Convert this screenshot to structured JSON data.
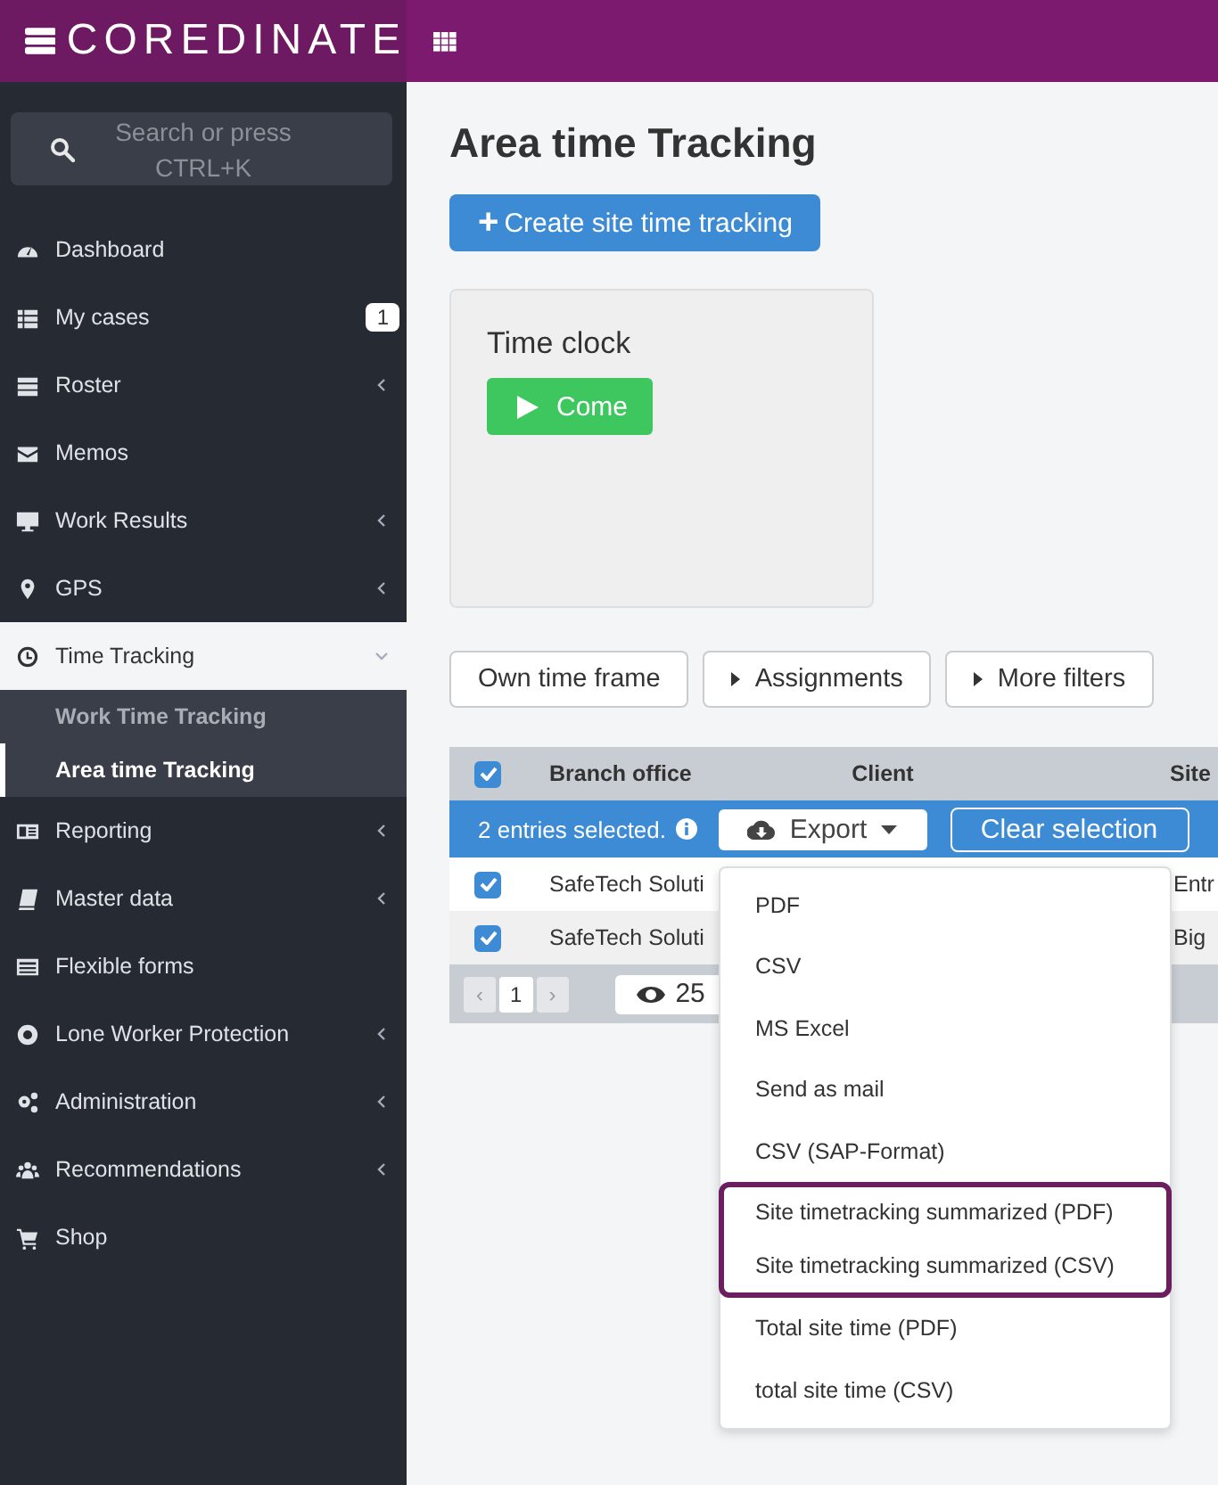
{
  "brand": {
    "name": "COREDINATE"
  },
  "search": {
    "placeholder": "Search or press CTRL+K"
  },
  "sidebar": {
    "items": [
      {
        "label": "Dashboard",
        "has_submenu": false,
        "selected": false
      },
      {
        "label": "My cases",
        "badge": "1",
        "has_submenu": false,
        "selected": false
      },
      {
        "label": "Roster",
        "has_submenu": true,
        "expanded": false,
        "selected": false
      },
      {
        "label": "Memos",
        "has_submenu": false,
        "selected": false
      },
      {
        "label": "Work Results",
        "has_submenu": true,
        "expanded": false,
        "selected": false
      },
      {
        "label": "GPS",
        "has_submenu": true,
        "expanded": false,
        "selected": false
      },
      {
        "label": "Time Tracking",
        "has_submenu": true,
        "expanded": true,
        "selected": true,
        "children": [
          {
            "label": "Work Time Tracking",
            "selected": false
          },
          {
            "label": "Area time Tracking",
            "selected": true
          }
        ]
      },
      {
        "label": "Reporting",
        "has_submenu": true,
        "expanded": false,
        "selected": false
      },
      {
        "label": "Master data",
        "has_submenu": true,
        "expanded": false,
        "selected": false
      },
      {
        "label": "Flexible forms",
        "has_submenu": false,
        "selected": false
      },
      {
        "label": "Lone Worker Protection",
        "has_submenu": true,
        "expanded": false,
        "selected": false
      },
      {
        "label": "Administration",
        "has_submenu": true,
        "expanded": false,
        "selected": false
      },
      {
        "label": "Recommendations",
        "has_submenu": true,
        "expanded": false,
        "selected": false
      },
      {
        "label": "Shop",
        "has_submenu": false,
        "selected": false
      }
    ]
  },
  "page": {
    "title": "Area time Tracking",
    "create_button": "Create site time tracking",
    "create_icon": "+"
  },
  "time_clock": {
    "title": "Time clock",
    "button": "Come"
  },
  "filters": [
    {
      "label": "Own time frame",
      "has_caret": false
    },
    {
      "label": "Assignments",
      "has_caret": true
    },
    {
      "label": "More filters",
      "has_caret": true
    }
  ],
  "table": {
    "all_checked": true,
    "columns": [
      "Branch office",
      "Client",
      "Site"
    ],
    "selection_text": "2 entries selected.",
    "export_button": "Export",
    "clear_button": "Clear selection",
    "rows": [
      {
        "checked": true,
        "branch_office": "SafeTech Soluti",
        "site": "Entr"
      },
      {
        "checked": true,
        "branch_office": "SafeTech Soluti",
        "site": "Big"
      }
    ],
    "pager": {
      "prev": "‹",
      "page": "1",
      "next": "›",
      "page_size": "25"
    }
  },
  "export_menu": {
    "items": [
      {
        "label": "PDF",
        "highlighted": false
      },
      {
        "label": "CSV",
        "highlighted": false
      },
      {
        "label": "MS Excel",
        "highlighted": false
      },
      {
        "label": "Send as mail",
        "highlighted": false
      },
      {
        "label": "CSV (SAP-Format)",
        "highlighted": false
      },
      {
        "label": "Site timetracking summarized (PDF)",
        "highlighted": true
      },
      {
        "label": "Site timetracking summarized (CSV)",
        "highlighted": true
      },
      {
        "label": "Total site time (PDF)",
        "highlighted": false
      },
      {
        "label": "total site time (CSV)",
        "highlighted": false
      }
    ]
  }
}
